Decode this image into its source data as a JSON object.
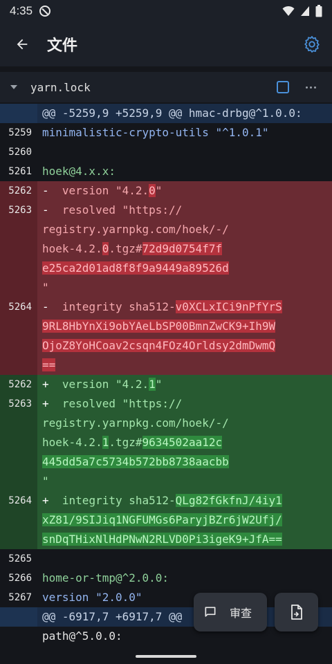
{
  "status": {
    "time": "4:35"
  },
  "app_bar": {
    "title": "文件"
  },
  "file": {
    "name": "yarn.lock"
  },
  "diff": {
    "hunk1": "@@ -5259,9 +5259,9 @@ hmac-drbg@^1.0.0:",
    "ctx": [
      {
        "num": "5259",
        "text": "minimalistic-crypto-utils \"^1.0.1\""
      },
      {
        "num": "5260",
        "text": ""
      },
      {
        "num": "5261",
        "text": "hoek@4.x.x:"
      }
    ],
    "del": {
      "version": {
        "num": "5262",
        "sign": "-",
        "pre": "  version \"4.2.",
        "hl": "0",
        "post": "\""
      },
      "resolved": {
        "num": "5263",
        "sign": "-",
        "line1": "  resolved \"https://",
        "line2": "registry.yarnpkg.com/hoek/-/",
        "pre3": "hoek-4.2.",
        "hl3": "0",
        "mid3": ".tgz#",
        "hash1": "72d9d0754f7f",
        "hash2": "e25ca2d01ad8f8f9a9449a89526d",
        "end": "\""
      },
      "integrity": {
        "num": "5264",
        "sign": "-",
        "pre": "  integrity sha512-",
        "l1": "v0XCLxICi9nPfYrS",
        "l2": "9RL8HbYnXi9obYAeLbSP00BmnZwCK9+Ih9W",
        "l3": "OjoZ8YoHCoav2csqn4FOz4Orldsy2dmDwmQ",
        "l4": "=="
      }
    },
    "add": {
      "version": {
        "num": "5262",
        "sign": "+",
        "pre": "  version \"4.2.",
        "hl": "1",
        "post": "\""
      },
      "resolved": {
        "num": "5263",
        "sign": "+",
        "line1": "  resolved \"https://",
        "line2": "registry.yarnpkg.com/hoek/-/",
        "pre3": "hoek-4.2.",
        "hl3": "1",
        "mid3": ".tgz#",
        "hash1": "9634502aa12c",
        "hash2": "445dd5a7c5734b572bb8738aacbb",
        "end": "\""
      },
      "integrity": {
        "num": "5264",
        "sign": "+",
        "pre": "  integrity sha512-",
        "l1": "QLg82fGkfnJ/4iy1",
        "l2": "xZ81/9SIJiq1NGFUMGs6ParyjBZr6jW2Ufj/",
        "l3": "snDqTHixNlHdPNwN2RLVD0Pi3igeK9+JfA",
        "l4": "=="
      }
    },
    "ctx2": [
      {
        "num": "5265",
        "text": ""
      },
      {
        "num": "5266",
        "text": "home-or-tmp@^2.0.0:"
      },
      {
        "num": "5267",
        "text": "version \"2.0.0\""
      }
    ],
    "hunk2": "@@ -6917,7 +6917,7 @@",
    "hunk2_cont": "path@^5.0.0:"
  },
  "fab": {
    "review_label": "审查"
  },
  "colors": {
    "accent": "#4a90d9",
    "del_bg": "#6a2b33",
    "add_bg": "#275a31",
    "hunk_bg": "#1d3351"
  },
  "icons": {
    "back": "arrow-left-icon",
    "settings": "gear-icon",
    "caret": "caret-down-icon",
    "more": "more-horizontal-icon",
    "comment": "comment-icon",
    "file": "file-diff-icon"
  }
}
